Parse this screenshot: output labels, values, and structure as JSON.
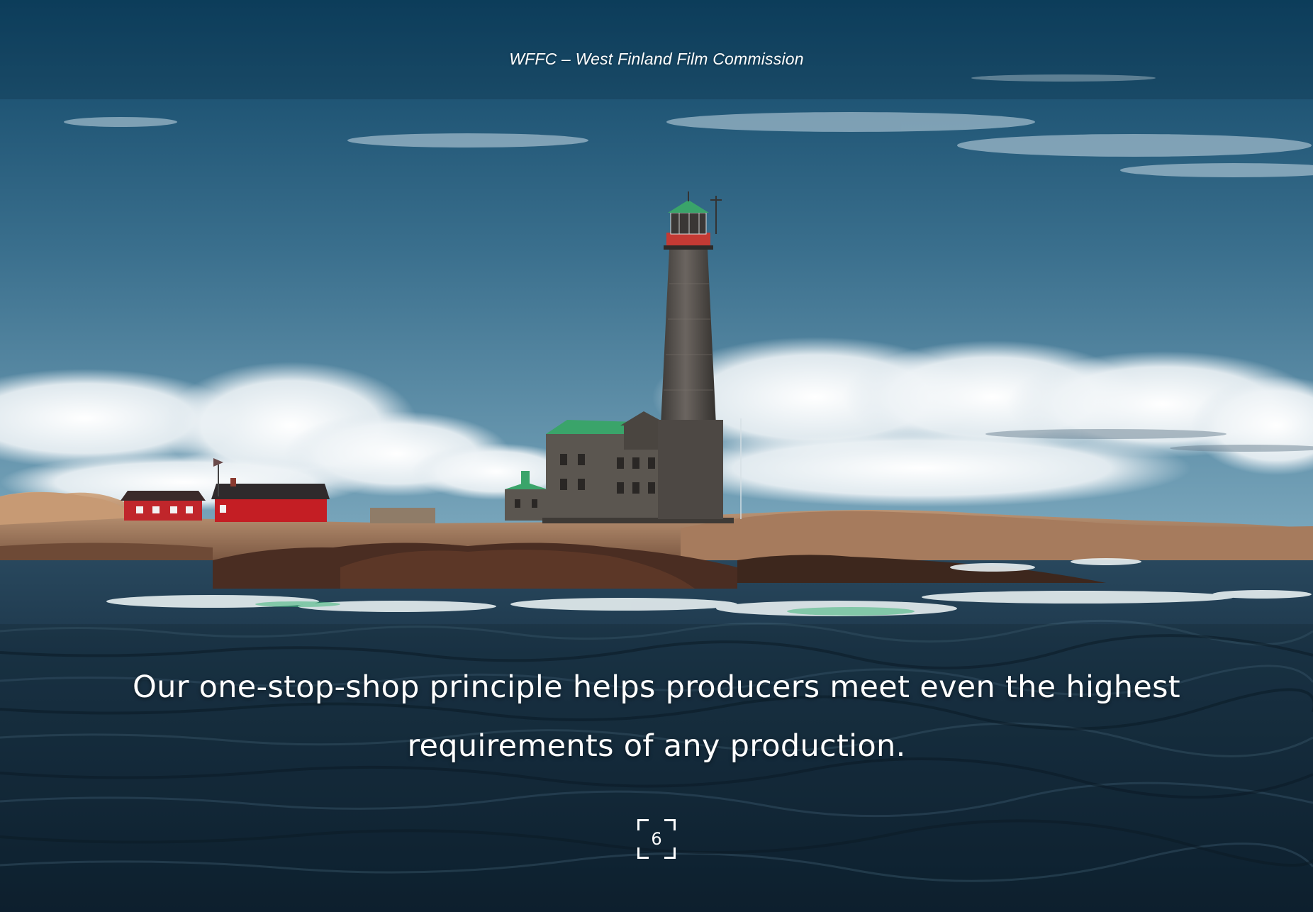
{
  "header": {
    "text": "WFFC – West Finland Film Commission"
  },
  "tagline": {
    "line1": "Our one-stop-shop principle helps producers meet even the highest",
    "line2": "requirements of any production."
  },
  "page": {
    "number": "6"
  },
  "colors": {
    "sky_top": "#0f4a6a",
    "sky_bottom": "#6a9ab2",
    "sea": "#1b3447",
    "rock": "#c9a07e",
    "house_red": "#c0262b",
    "roof_green": "#3aa46a",
    "stone": "#5b5650"
  }
}
